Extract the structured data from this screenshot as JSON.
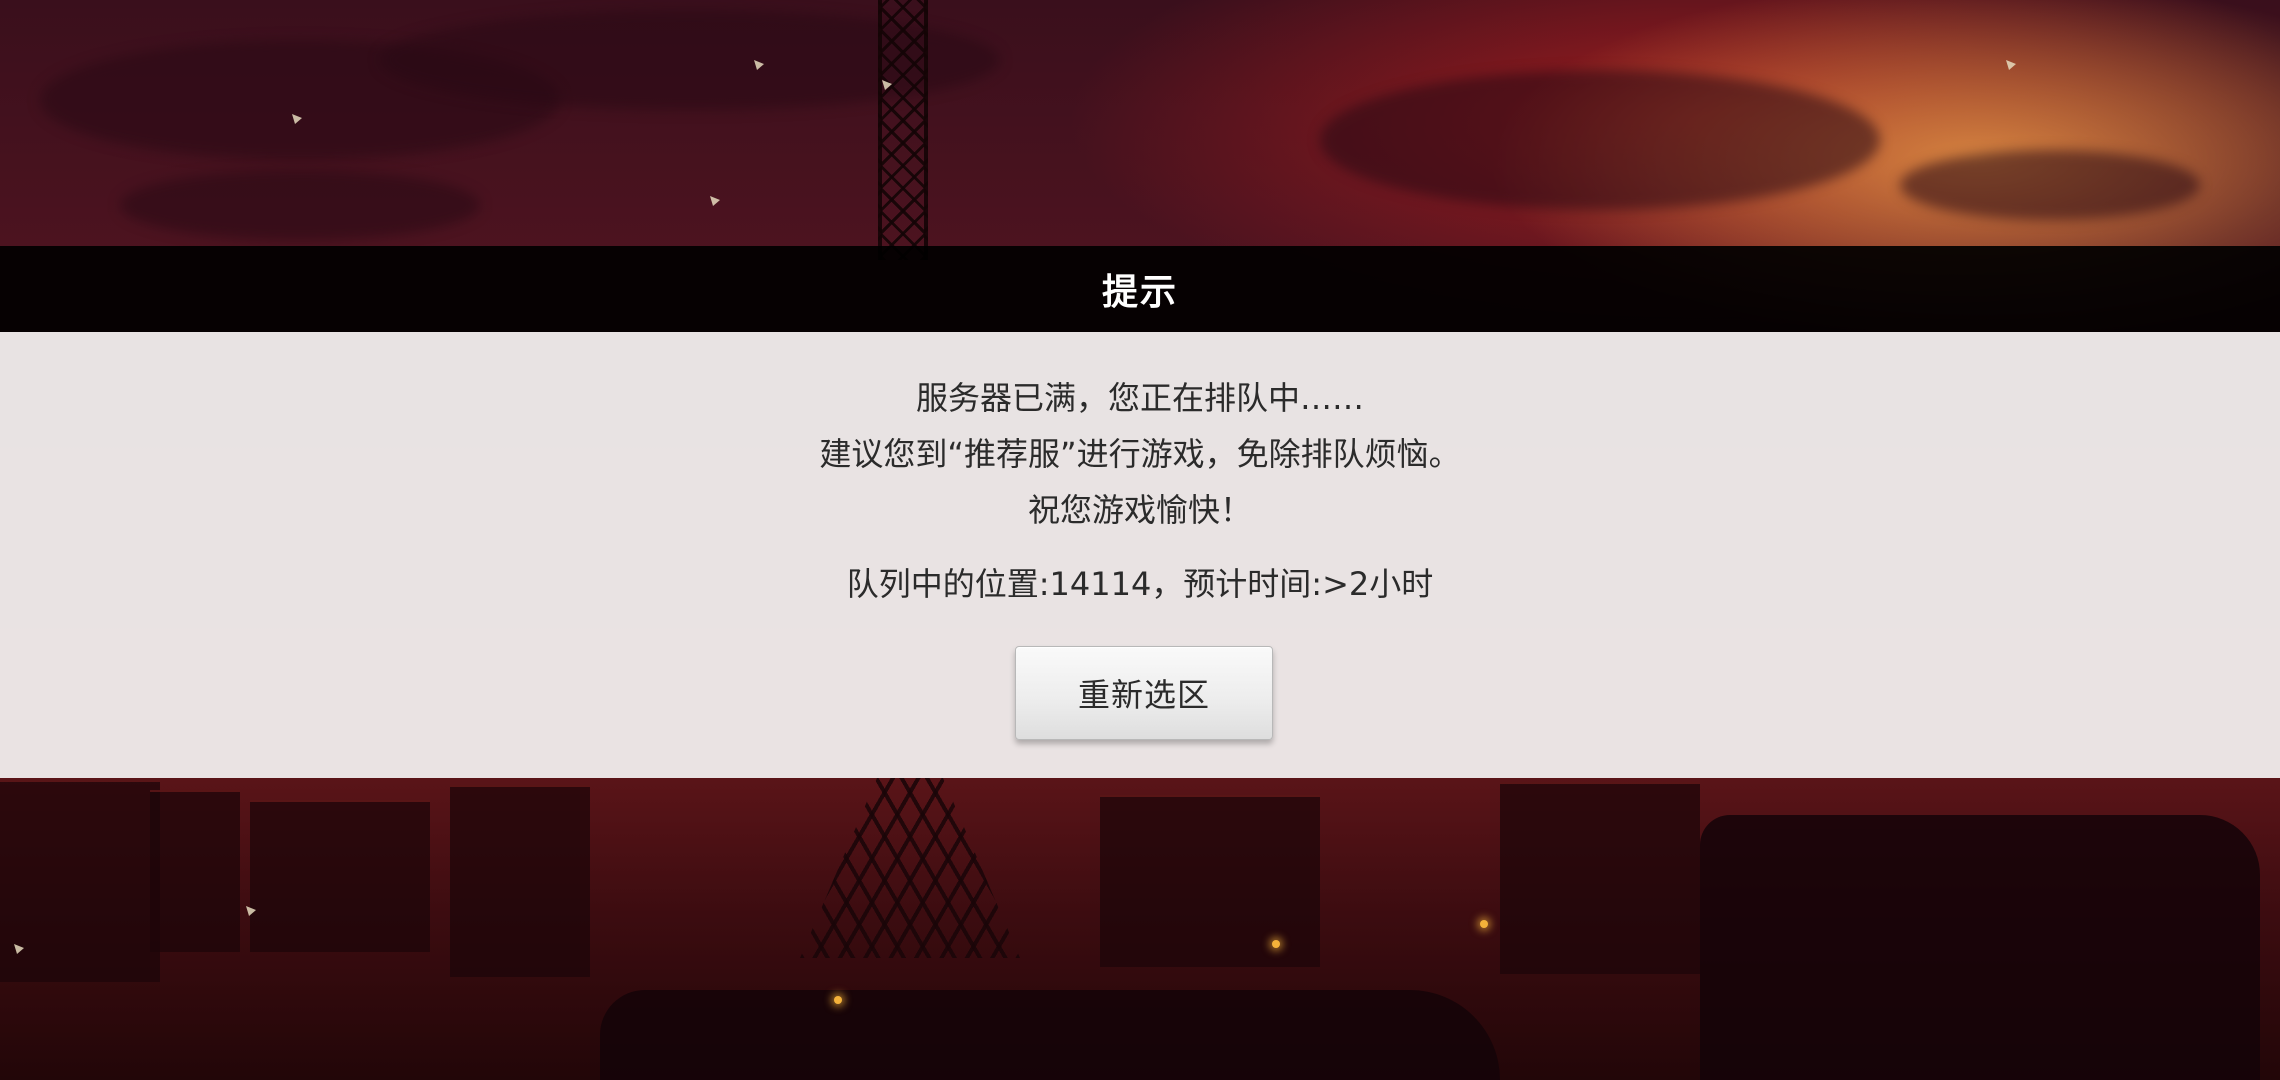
{
  "dialog": {
    "title": "提示",
    "message_lines": [
      "服务器已满，您正在排队中……",
      "建议您到“推荐服”进行游戏，免除排队烦恼。",
      "祝您游戏愉快！"
    ],
    "queue_status": "队列中的位置:14114，预计时间:>2小时",
    "reselect_button_label": "重新选区"
  },
  "theme": {
    "title_bar_color": "#000000",
    "panel_color": "#f0eeee",
    "text_color": "#2b2b2b"
  }
}
